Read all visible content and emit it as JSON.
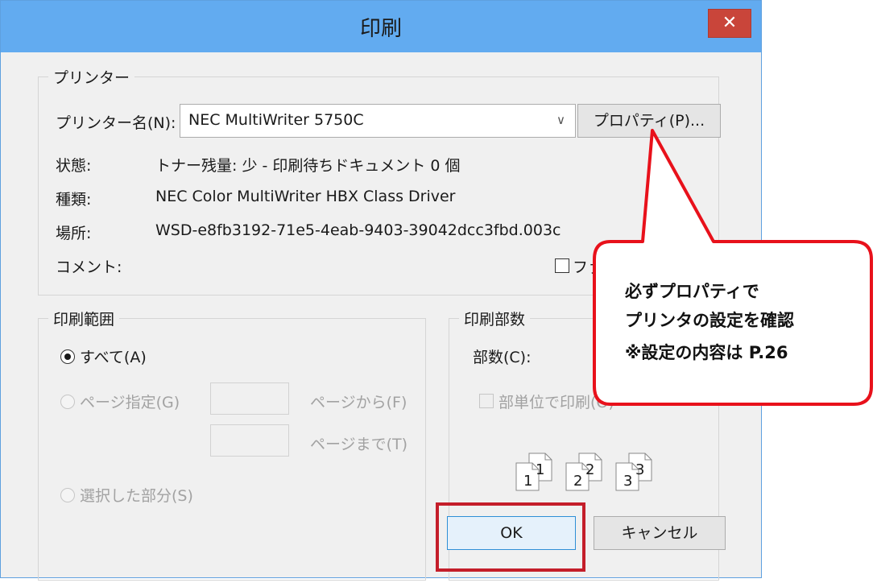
{
  "dialog": {
    "title": "印刷",
    "close_glyph": "✕",
    "printer_group": {
      "label": "プリンター",
      "name_label": "プリンター名(N):",
      "printer_name": "NEC MultiWriter 5750C",
      "properties_button": "プロパティ(P)...",
      "status_label": "状態:",
      "status_value": "トナー残量: 少 - 印刷待ちドキュメント 0 個",
      "type_label": "種類:",
      "type_value": "NEC Color MultiWriter HBX Class Driver",
      "location_label": "場所:",
      "location_value": "WSD-e8fb3192-71e5-4eab-9403-39042dcc3fbd.003c",
      "comment_label": "コメント:",
      "file_checkbox_label": "ファ"
    },
    "range_group": {
      "label": "印刷範囲",
      "all_option": "すべて(A)",
      "pages_option": "ページ指定(G)",
      "from_label": "ページから(F)",
      "to_label": "ページまで(T)",
      "selection_option": "選択した部分(S)"
    },
    "copies_group": {
      "label": "印刷部数",
      "copies_label": "部数(C):",
      "collate_label": "部単位で印刷(O)",
      "collate_icons": [
        "1",
        "1",
        "2",
        "2",
        "3",
        "3"
      ]
    },
    "ok_button": "OK",
    "cancel_button": "キャンセル"
  },
  "callout": {
    "line1": "必ずプロパティで",
    "line2": "プリンタの設定を確認",
    "line3": "※設定の内容は P.26",
    "color": "#e8111b"
  },
  "colors": {
    "titlebar": "#62abf0",
    "close_button": "#c9453a",
    "highlight": "#c41e2a"
  }
}
